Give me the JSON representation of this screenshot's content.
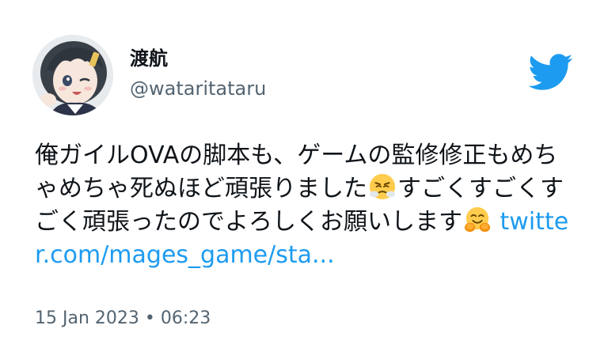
{
  "author": {
    "display_name": "渡航",
    "handle": "@wataritataru"
  },
  "tweet": {
    "text_part1": "俺ガイルOVAの脚本も、ゲームの監修修正もめちゃめちゃ死ぬほど頑張りました",
    "emoji1": "face-with-steam-from-nose",
    "text_part2": "すごくすごくすごく頑張ったのでよろしくお願いします",
    "emoji2": "hugging-face",
    "link_text": "twitter.com/mages_game/sta..."
  },
  "meta": {
    "timestamp": "15 Jan 2023 • 06:23"
  },
  "colors": {
    "brand": "#1d9bf0",
    "text": "#0f1419",
    "secondary": "#536471"
  }
}
